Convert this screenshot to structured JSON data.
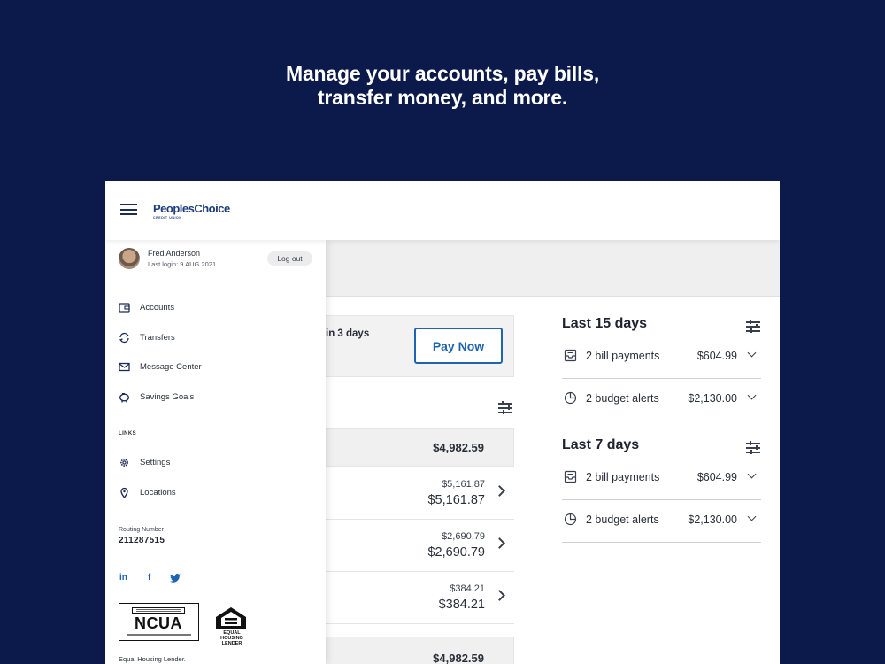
{
  "headline": {
    "line1": "Manage your accounts, pay bills,",
    "line2": "transfer money, and more."
  },
  "brand": {
    "name": "PeoplesChoice",
    "tagline": "CREDIT UNION"
  },
  "user": {
    "name": "Fred Anderson",
    "last_login": "Last login: 9 AUG 2021",
    "logout_label": "Log out"
  },
  "nav": {
    "items": [
      {
        "label": "Accounts",
        "icon": "wallet-icon"
      },
      {
        "label": "Transfers",
        "icon": "transfer-icon"
      },
      {
        "label": "Message Center",
        "icon": "envelope-icon"
      },
      {
        "label": "Savings Goals",
        "icon": "piggy-bank-icon"
      }
    ],
    "links_heading": "LINKS",
    "links": [
      {
        "label": "Settings",
        "icon": "gear-icon"
      },
      {
        "label": "Locations",
        "icon": "location-pin-icon"
      }
    ]
  },
  "routing": {
    "label": "Routing Number",
    "number": "211287515"
  },
  "social": {
    "linkedin": "in",
    "facebook": "f"
  },
  "badges": {
    "ncua": "NCUA",
    "ehl": "EQUAL HOUSING LENDER"
  },
  "footer_note": "Equal Housing Lender.",
  "bill_due": {
    "text": "in 3 days",
    "pay_label": "Pay Now"
  },
  "accounts": {
    "total_top": "$4,982.59",
    "rows": [
      {
        "small": "$5,161.87",
        "big": "$5,161.87"
      },
      {
        "small": "$2,690.79",
        "big": "$2,690.79"
      },
      {
        "small": "$384.21",
        "big": "$384.21"
      }
    ],
    "total_bottom": "$4,982.59"
  },
  "periods": [
    {
      "title": "Last 15 days",
      "rows": [
        {
          "label": "2 bill payments",
          "amount": "$604.99",
          "icon": "bill-icon"
        },
        {
          "label": "2 budget alerts",
          "amount": "$2,130.00",
          "icon": "pie-chart-icon"
        }
      ]
    },
    {
      "title": "Last 7 days",
      "rows": [
        {
          "label": "2 bill payments",
          "amount": "$604.99",
          "icon": "bill-icon"
        },
        {
          "label": "2 budget alerts",
          "amount": "$2,130.00",
          "icon": "pie-chart-icon"
        }
      ]
    }
  ],
  "colors": {
    "background": "#0b1a4a",
    "accent": "#1e64b0",
    "brand": "#1d3a7a"
  }
}
